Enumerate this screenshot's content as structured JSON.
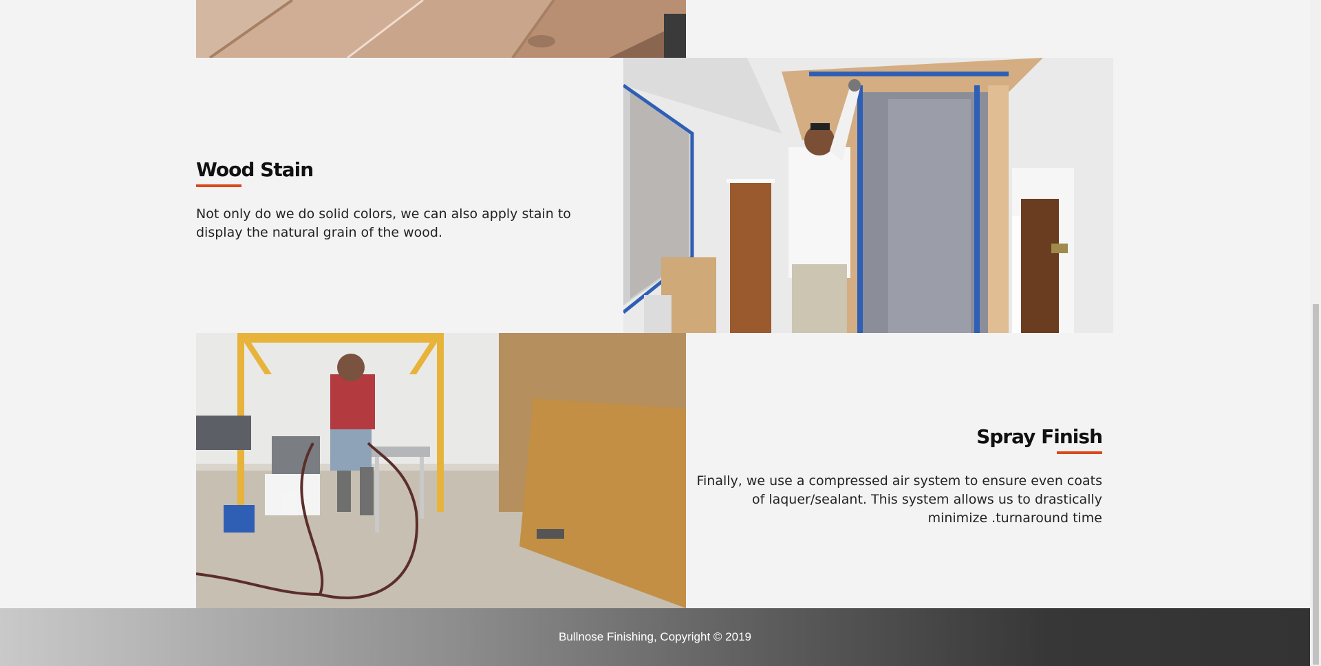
{
  "sections": {
    "wood_stain": {
      "title": "Wood Stain",
      "description": "Not only do we do solid colors, we can also apply stain to display the natural grain of the wood."
    },
    "spray_finish": {
      "title": "Spray Finish",
      "description": "Finally, we use a compressed air system to ensure even coats of laquer/sealant. This system allows us to drastically minimize .turnaround time"
    }
  },
  "footer": {
    "copyright": "Bullnose Finishing, Copyright © 2019"
  },
  "colors": {
    "accent": "#d9491a",
    "background": "#f3f3f3",
    "footer_dark": "#333333"
  }
}
